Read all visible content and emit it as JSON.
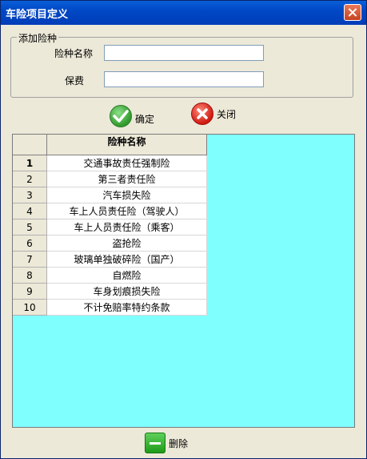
{
  "window": {
    "title": "车险项目定义"
  },
  "group": {
    "title": "添加险种"
  },
  "form": {
    "name_label": "险种名称",
    "name_value": "",
    "premium_label": "保费",
    "premium_value": ""
  },
  "buttons": {
    "ok": "确定",
    "close": "关闭",
    "delete": "删除"
  },
  "grid": {
    "column_header": "险种名称",
    "rows": [
      {
        "num": "1",
        "name": "交通事故责任强制险"
      },
      {
        "num": "2",
        "name": "第三者责任险"
      },
      {
        "num": "3",
        "name": "汽车损失险"
      },
      {
        "num": "4",
        "name": "车上人员责任险（驾驶人）"
      },
      {
        "num": "5",
        "name": "车上人员责任险（乘客）"
      },
      {
        "num": "6",
        "name": "盗抢险"
      },
      {
        "num": "7",
        "name": "玻璃单独破碎险（国产）"
      },
      {
        "num": "8",
        "name": "自燃险"
      },
      {
        "num": "9",
        "name": "车身划痕损失险"
      },
      {
        "num": "10",
        "name": "不计免赔率特约条款"
      }
    ]
  },
  "colors": {
    "grid_background": "#80ffff",
    "titlebar": "#0048c6"
  }
}
